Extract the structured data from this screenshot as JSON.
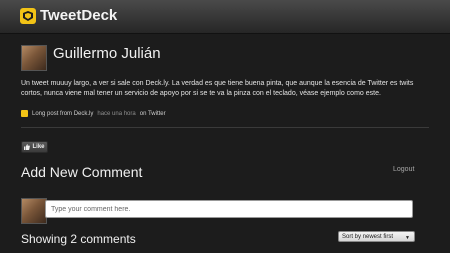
{
  "app": {
    "title": "TweetDeck"
  },
  "tweet": {
    "author": "Guillermo Julián",
    "text": "Un tweet muuuy largo, a ver si sale con Deck.ly. La verdad es que tiene buena pinta, que aunque la esencia de Twitter es twits cortos, nunca viene mal tener un servicio de apoyo por si se te va la pinza con el teclado, véase ejemplo como este.",
    "source_label": "Long post from Deck.ly",
    "time": "hace una hora",
    "via": "on Twitter"
  },
  "actions": {
    "like_label": "Like"
  },
  "comments": {
    "heading": "Add New Comment",
    "logout_label": "Logout",
    "input_placeholder": "Type your comment here.",
    "count_heading": "Showing 2 comments",
    "sort_label": "Sort by newest first"
  },
  "colors": {
    "accent": "#f2c316",
    "background": "#1c1c1c"
  }
}
